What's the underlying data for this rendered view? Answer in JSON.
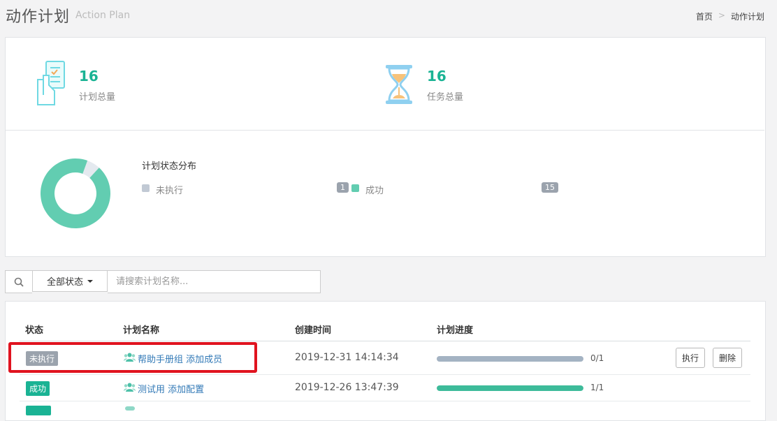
{
  "header": {
    "title": "动作计划",
    "subtitle": "Action Plan",
    "breadcrumb": [
      "首页",
      "动作计划"
    ],
    "breadcrumb_sep": ">"
  },
  "stats": {
    "plans": {
      "value": "16",
      "label": "计划总量",
      "icon": "checklist-icon"
    },
    "tasks": {
      "value": "16",
      "label": "任务总量",
      "icon": "hourglass-icon"
    }
  },
  "distribution": {
    "title": "计划状态分布",
    "items": [
      {
        "label": "未执行",
        "count": "1",
        "color": "#c1c9d4"
      },
      {
        "label": "成功",
        "count": "15",
        "color": "#62cdb1"
      }
    ]
  },
  "filter": {
    "status_button": "全部状态",
    "search_placeholder": "请搜索计划名称..."
  },
  "table": {
    "columns": [
      "状态",
      "计划名称",
      "创建时间",
      "计划进度"
    ],
    "rows": [
      {
        "status": "未执行",
        "name": "帮助手册组 添加成员",
        "created": "2019-12-31 14:14:34",
        "progress_text": "0/1",
        "progress": 0.0,
        "actions": [
          "执行",
          "删除"
        ]
      },
      {
        "status": "成功",
        "name": "测试用 添加配置",
        "created": "2019-12-26 13:47:39",
        "progress_text": "1/1",
        "progress": 1.0
      }
    ]
  },
  "colors": {
    "accent": "#1ab394",
    "highlight": "#e0131f",
    "pending_bar": "#a4b3c3",
    "success_bar": "#3dbb9a"
  }
}
